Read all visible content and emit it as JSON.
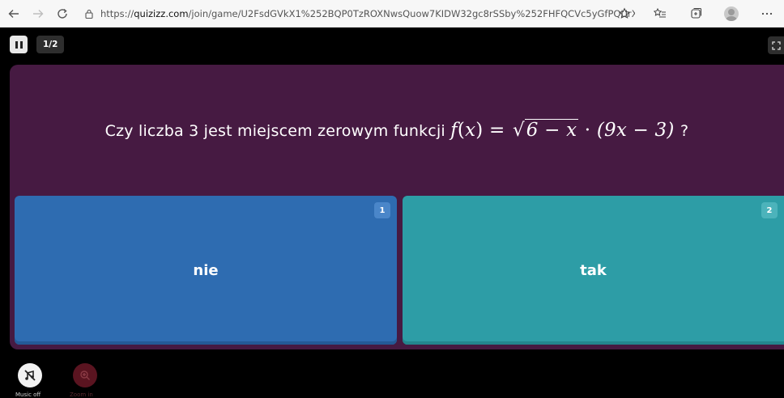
{
  "browser": {
    "url_prefix": "https://",
    "url_domain": "quizizz.com",
    "url_path": "/join/game/U2FsdGVkX1%252BQP0TzROXNwsQuow7KIDW32gc8rSSby%252FHFQCVc5yGfPQUrXePh7Rf6uVe9j9..."
  },
  "game": {
    "counter": "1/2",
    "question": {
      "prefix": "Czy liczba 3 jest miejscem zerowym funkcji",
      "math_f": "f",
      "math_lparen": "(",
      "math_x": "x",
      "math_rparen": ")",
      "math_eq": " = ",
      "math_sqrt_body": "6 − x",
      "math_dot": " · ",
      "math_factor": "(9x − 3)",
      "suffix": "?"
    },
    "options": [
      {
        "number": "1",
        "label": "nie",
        "color": "#2e6cb1"
      },
      {
        "number": "2",
        "label": "tak",
        "color": "#2d9da6"
      }
    ],
    "controls": {
      "music_label": "Music off",
      "zoom_label": "Zoom in"
    }
  },
  "colors": {
    "card_bg": "#461a42",
    "page_bg": "#000000"
  }
}
